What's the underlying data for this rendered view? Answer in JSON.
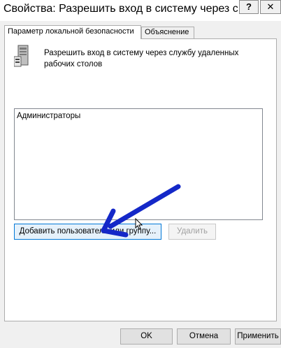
{
  "window": {
    "title": "Свойства: Разрешить вход в систему через слу",
    "help_label": "?",
    "close_label": "✕"
  },
  "tabs": [
    {
      "label": "Параметр локальной безопасности",
      "active": true
    },
    {
      "label": "Объяснение",
      "active": false
    }
  ],
  "policy": {
    "icon": "server-policy-icon",
    "description": "Разрешить вход в систему через службу удаленных рабочих столов"
  },
  "members": {
    "items": [
      "Администраторы"
    ]
  },
  "buttons": {
    "add": "Добавить пользователя или группу...",
    "remove": "Удалить",
    "ok": "OK",
    "cancel": "Отмена",
    "apply": "Применить"
  },
  "annotation": {
    "icon": "pointer-arrow-icon",
    "color": "#1428c8"
  }
}
